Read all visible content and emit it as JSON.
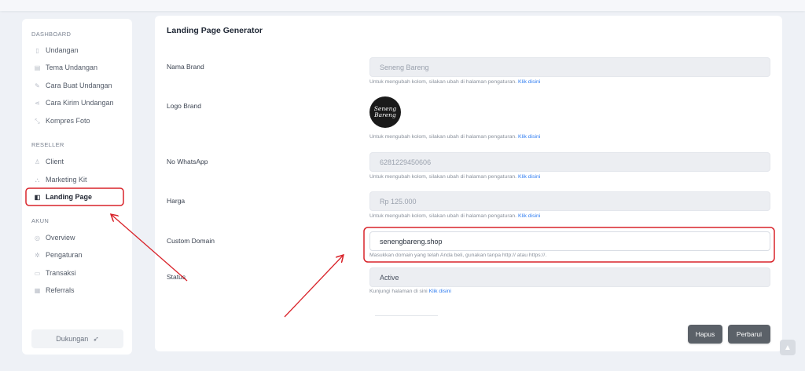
{
  "sidebar": {
    "sections": {
      "dashboard": "DASHBOARD",
      "reseller": "RESELLER",
      "akun": "AKUN"
    },
    "items": [
      {
        "label": "Undangan",
        "icon": "invitation-icon"
      },
      {
        "label": "Tema Undangan",
        "icon": "theme-icon"
      },
      {
        "label": "Cara Buat Undangan",
        "icon": "pencil-icon"
      },
      {
        "label": "Cara Kirim Undangan",
        "icon": "share-icon"
      },
      {
        "label": "Kompres Foto",
        "icon": "compress-icon"
      },
      {
        "label": "Client",
        "icon": "user-icon"
      },
      {
        "label": "Marketing Kit",
        "icon": "kit-icon"
      },
      {
        "label": "Landing Page",
        "icon": "layers-icon"
      },
      {
        "label": "Overview",
        "icon": "overview-icon"
      },
      {
        "label": "Pengaturan",
        "icon": "gear-icon"
      },
      {
        "label": "Transaksi",
        "icon": "wallet-icon"
      },
      {
        "label": "Referrals",
        "icon": "referral-icon"
      }
    ],
    "support_label": "Dukungan"
  },
  "main": {
    "title": "Landing Page Generator",
    "fields": {
      "brand": {
        "label": "Nama Brand",
        "value": "Seneng Bareng"
      },
      "logo": {
        "label": "Logo Brand",
        "logo_text_1": "Seneng",
        "logo_text_2": "Bareng"
      },
      "whatsapp": {
        "label": "No WhatsApp",
        "value": "6281229450606"
      },
      "price": {
        "label": "Harga",
        "value": "Rp 125.000"
      },
      "domain": {
        "label": "Custom Domain",
        "value": "senengbareng.shop",
        "help": "Masukkan domain yang telah Anda beli, gunakan tanpa http:// atau https://."
      },
      "status": {
        "label": "Status",
        "value": "Active",
        "help": "Kunjungi halaman di sini",
        "link": "Klik disini"
      }
    },
    "settings_help": "Untuk mengubah kolom, silakan ubah di halaman pengaturan.",
    "settings_link": "Klik disini",
    "buttons": {
      "delete": "Hapus",
      "update": "Perbarui"
    }
  },
  "colors": {
    "annotation": "#d9232a",
    "link": "#2f7cf0",
    "button": "#5b6168"
  }
}
